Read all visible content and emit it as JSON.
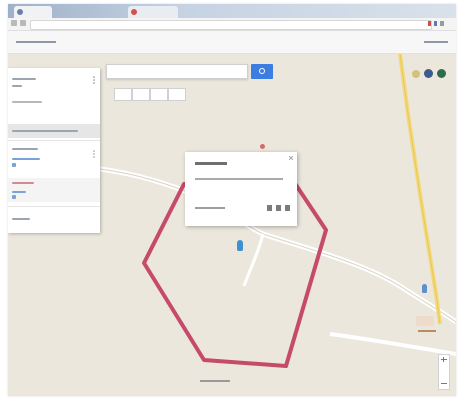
{
  "browser": {
    "tabs": [
      {
        "title": "",
        "icon": "globe-icon"
      },
      {
        "title": "",
        "icon": "map-icon"
      }
    ],
    "address": "",
    "bookmarks_label": ""
  },
  "map": {
    "search": {
      "value": "",
      "placeholder": ""
    },
    "panel": {
      "title": "",
      "subtitle": "",
      "section_header": "",
      "items": [
        {
          "label": "",
          "sub": "",
          "icon": "layer-icon"
        },
        {
          "label": "",
          "sub": "",
          "icon": "layer-icon"
        }
      ],
      "footer": ""
    },
    "info_window": {
      "title": "",
      "address": "",
      "detail": ""
    },
    "bottom_label": "",
    "polygon_color": "#c64a6a",
    "road_color": "#f0dc78",
    "accent_color": "#3b7de0"
  }
}
